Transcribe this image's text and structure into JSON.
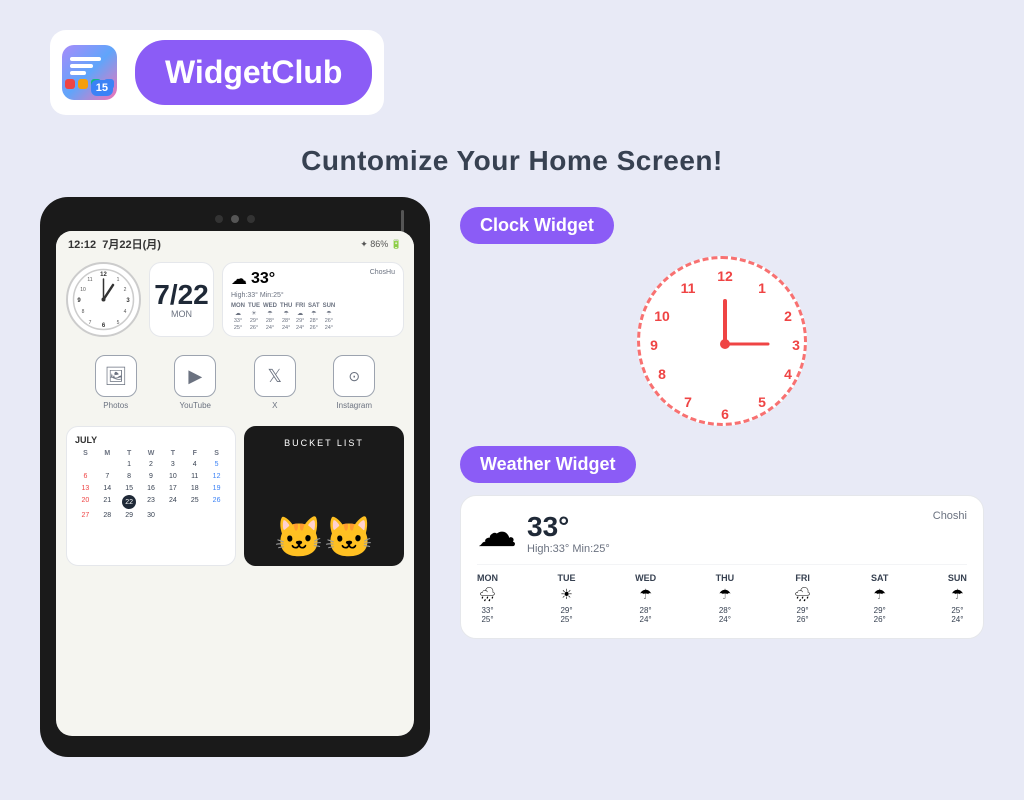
{
  "header": {
    "brand_name": "WidgetClub",
    "ios_badge": "15"
  },
  "tagline": "Cuntomize Your Home Screen!",
  "tablet": {
    "time": "12:12",
    "date_info": "7月22日(月)",
    "battery": "86%",
    "date_number": "7/22",
    "date_day": "mon",
    "weather": {
      "temp": "33°",
      "high": "High:33°",
      "low": "Min:25°",
      "location": "ChosHu",
      "days": [
        {
          "label": "MON",
          "temp1": "33°",
          "temp2": "25°"
        },
        {
          "label": "TUE",
          "temp1": "29°",
          "temp2": "26°"
        },
        {
          "label": "WED",
          "temp1": "28°",
          "temp2": "24°"
        },
        {
          "label": "THU",
          "temp1": "28°",
          "temp2": "24°"
        },
        {
          "label": "FRI",
          "temp1": "29°",
          "temp2": "24°"
        },
        {
          "label": "SAT",
          "temp1": "28°",
          "temp2": "26°"
        },
        {
          "label": "SUN",
          "temp1": "26°",
          "temp2": "24°"
        }
      ]
    },
    "apps": [
      {
        "label": "Photos",
        "icon": "🖼"
      },
      {
        "label": "YouTube",
        "icon": "▶"
      },
      {
        "label": "X",
        "icon": "𝕏"
      },
      {
        "label": "Instagram",
        "icon": "⊙"
      }
    ],
    "calendar": {
      "month": "JULY",
      "headers": [
        "S",
        "M",
        "T",
        "W",
        "T",
        "F",
        "S"
      ],
      "days": [
        [
          "",
          "",
          "1",
          "2",
          "3",
          "4",
          "5"
        ],
        [
          "6",
          "7",
          "8",
          "9",
          "10",
          "11",
          "12"
        ],
        [
          "13",
          "14",
          "15",
          "16",
          "17",
          "18",
          "19"
        ],
        [
          "20",
          "21",
          "22",
          "23",
          "24",
          "25",
          "26"
        ],
        [
          "27",
          "28",
          "29",
          "30",
          "",
          "",
          ""
        ]
      ],
      "today": "22"
    },
    "bucket_title": "BUCKET LIST"
  },
  "right_panel": {
    "clock_widget_label": "Clock Widget",
    "weather_widget_label": "Weather Widget",
    "clock": {
      "numbers": [
        {
          "n": "12",
          "angle": 0
        },
        {
          "n": "1",
          "angle": 30
        },
        {
          "n": "2",
          "angle": 60
        },
        {
          "n": "3",
          "angle": 90
        },
        {
          "n": "4",
          "angle": 120
        },
        {
          "n": "5",
          "angle": 150
        },
        {
          "n": "6",
          "angle": 180
        },
        {
          "n": "7",
          "angle": 210
        },
        {
          "n": "8",
          "angle": 240
        },
        {
          "n": "9",
          "angle": 270
        },
        {
          "n": "10",
          "angle": 300
        },
        {
          "n": "11",
          "angle": 330
        }
      ],
      "hour_angle": 0,
      "minute_angle": 90
    },
    "weather": {
      "temp": "33°",
      "high": "High:33°",
      "low": "Min:25°",
      "location": "Choshi",
      "forecast": [
        {
          "label": "MON",
          "icon": "🌧",
          "t1": "33°",
          "t2": "25°"
        },
        {
          "label": "TUE",
          "icon": "☀",
          "t1": "29°",
          "t2": "25°"
        },
        {
          "label": "WED",
          "icon": "☂",
          "t1": "28°",
          "t2": "24°"
        },
        {
          "label": "THU",
          "icon": "☂",
          "t1": "28°",
          "t2": "24°"
        },
        {
          "label": "FRI",
          "icon": "🌧",
          "t1": "29°",
          "t2": "26°"
        },
        {
          "label": "SAT",
          "icon": "☂",
          "t1": "29°",
          "t2": "26°"
        },
        {
          "label": "SUN",
          "icon": "☂",
          "t1": "25°",
          "t2": "24°"
        }
      ]
    }
  }
}
